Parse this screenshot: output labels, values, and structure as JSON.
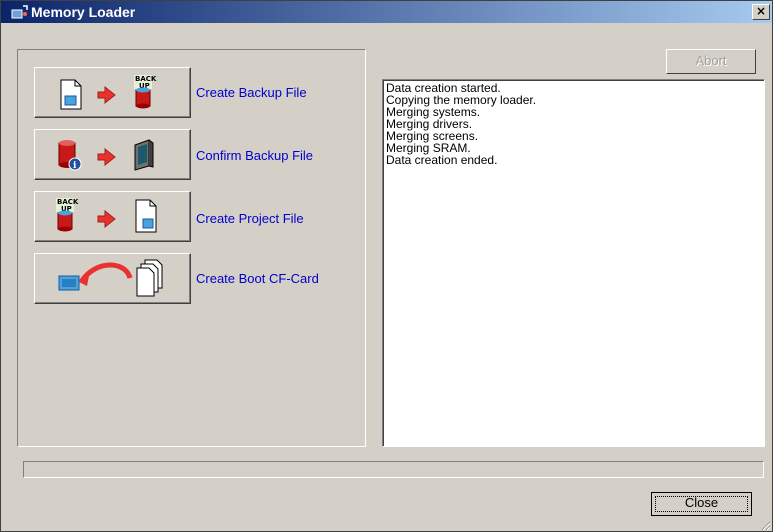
{
  "window": {
    "title": "Memory Loader",
    "close_glyph": "×"
  },
  "actions": [
    {
      "label": "Create Backup File",
      "icon": "file-to-backup-icon"
    },
    {
      "label": "Confirm Backup File",
      "icon": "backup-info-to-monitor-icon"
    },
    {
      "label": "Create Project File",
      "icon": "backup-to-file-icon"
    },
    {
      "label": "Create Boot CF-Card",
      "icon": "files-to-cf-card-icon"
    }
  ],
  "abort_label": "Abort",
  "log": [
    "Data creation started.",
    "Copying the memory loader.",
    "Merging systems.",
    "Merging drivers.",
    "Merging screens.",
    "Merging SRAM.",
    "Data creation ended."
  ],
  "progress_fraction": 0,
  "close_label": "Close",
  "colors": {
    "title_start": "#0a246a",
    "title_end": "#a6caf0",
    "link": "#0000cc",
    "face": "#d4d0c8",
    "arrow": "#e8322e"
  }
}
